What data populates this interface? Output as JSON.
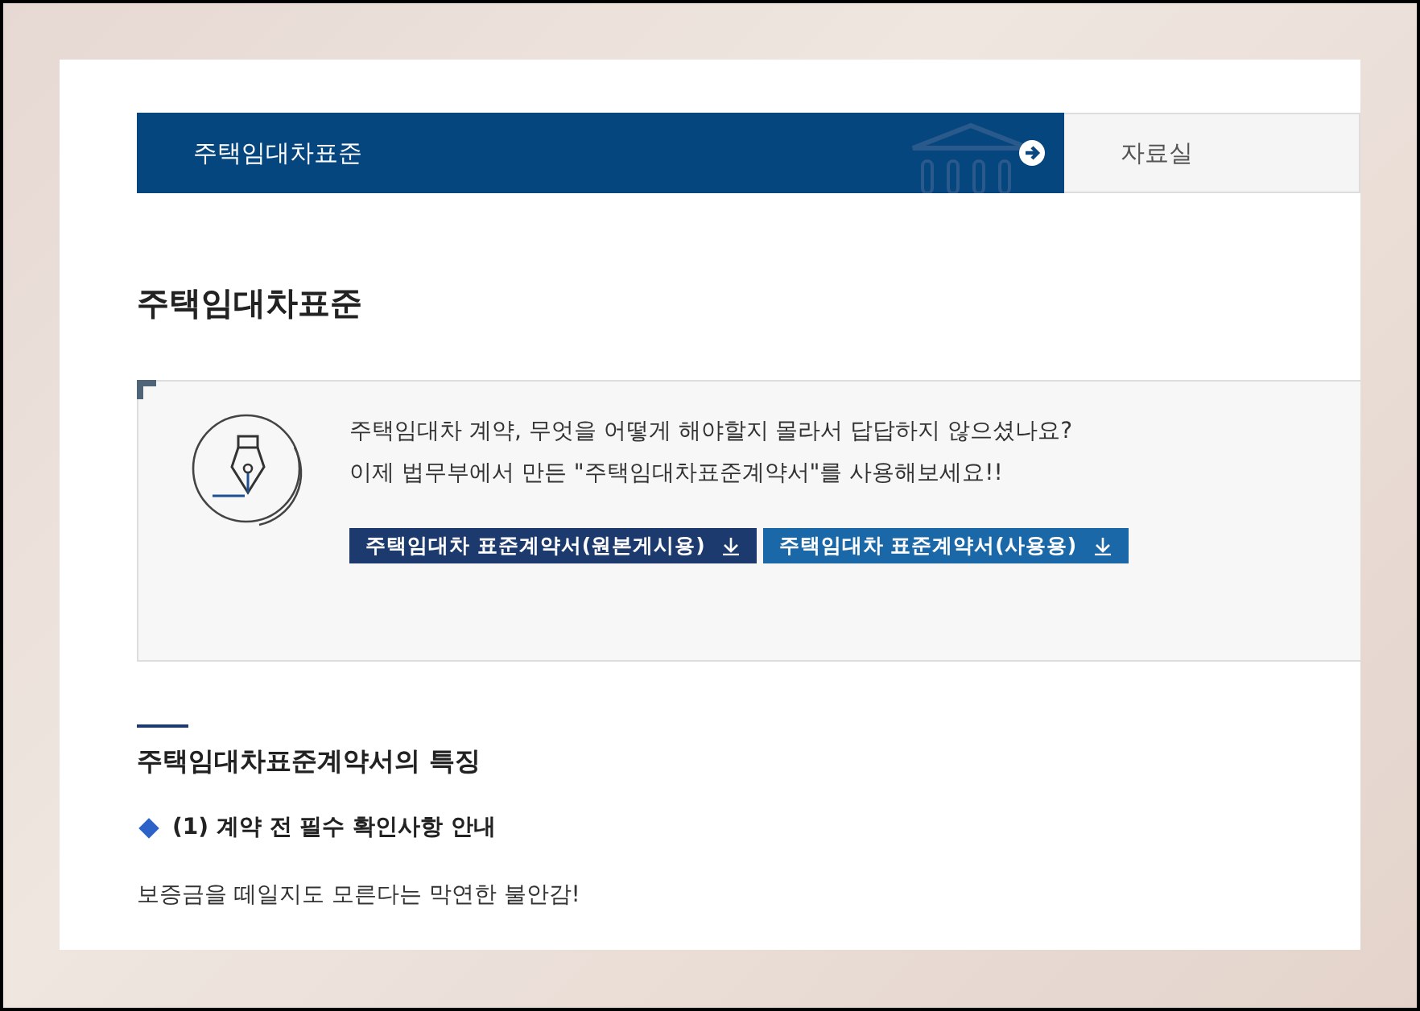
{
  "tabs": [
    {
      "label": "주택임대차표준",
      "selected": true
    },
    {
      "label": "자료실",
      "selected": false
    }
  ],
  "page_title": "주택임대차표준",
  "info_box": {
    "lines": [
      "주택임대차 계약, 무엇을 어떻게 해야할지 몰라서 답답하지 않으셨나요?",
      "이제 법무부에서 만든 \"주택임대차표준계약서\"를 사용해보세요!!"
    ],
    "buttons": [
      {
        "label": "주택임대차 표준계약서(원본게시용)",
        "kind": "dark"
      },
      {
        "label": "주택임대차 표준계약서(사용용)",
        "kind": "light"
      }
    ]
  },
  "section": {
    "title": "주택임대차표준계약서의 특징",
    "subtitle": "(1) 계약 전 필수 확인사항 안내",
    "paragraph": "보증금을 떼일지도 모른다는 막연한 불안감!"
  }
}
